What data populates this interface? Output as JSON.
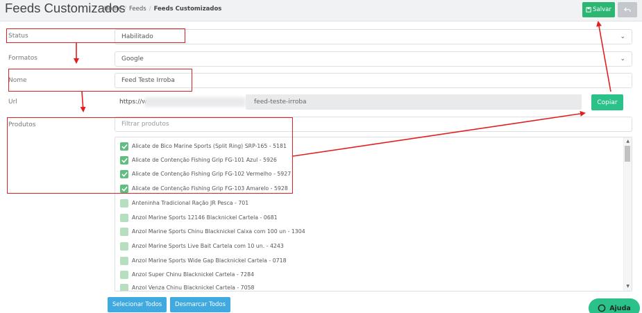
{
  "header": {
    "title": "Feeds Customizados",
    "breadcrumb": [
      "Home",
      "Feeds",
      "Feeds Customizados"
    ],
    "save_label": "Salvar"
  },
  "form": {
    "status": {
      "label": "Status",
      "value": "Habilitado"
    },
    "formatos": {
      "label": "Formatos",
      "value": "Google"
    },
    "nome": {
      "label": "Nome",
      "value": "Feed Teste Irroba"
    },
    "url": {
      "label": "Url",
      "prefix": "https://w",
      "slug": "feed-teste-irroba",
      "copy_label": "Copiar"
    },
    "produtos": {
      "label": "Produtos",
      "filter_placeholder": "Filtrar produtos"
    }
  },
  "products": [
    {
      "label": "Alicate de Bico Marine Sports (Split Ring) SRP-165 - 5181",
      "checked": true
    },
    {
      "label": "Alicate de Contenção Fishing Grip FG-101 Azul - 5926",
      "checked": true
    },
    {
      "label": "Alicate de Contenção Fishing Grip FG-102 Vermelho - 5927",
      "checked": true
    },
    {
      "label": "Alicate de Contenção Fishing Grip FG-103 Amarelo - 5928",
      "checked": true
    },
    {
      "label": "Anteninha Tradicional Ração JR Pesca - 701",
      "checked": false
    },
    {
      "label": "Anzol Marine Sports 12146 Blacknickel Cartela - 0681",
      "checked": false
    },
    {
      "label": "Anzol Marine Sports Chinu Blacknickel Caixa com 100 un - 1304",
      "checked": false
    },
    {
      "label": "Anzol Marine Sports Live Bait Cartela com 10 un. - 4243",
      "checked": false
    },
    {
      "label": "Anzol Marine Sports Wide Gap Blacknickel Cartela - 0718",
      "checked": false
    },
    {
      "label": "Anzol Super Chinu Blacknickel Cartela - 7284",
      "checked": false
    },
    {
      "label": "Anzol Venza Chinu Blacknickel Cartela - 7058",
      "checked": false
    }
  ],
  "actions": {
    "select_all": "Selecionar Todos",
    "deselect_all": "Desmarcar Todos",
    "help": "Ajuda"
  },
  "colors": {
    "save": "#2bb673",
    "copy": "#2bc28a",
    "blue_buttons": "#3fa9e0",
    "annotation": "#e21e1e"
  }
}
